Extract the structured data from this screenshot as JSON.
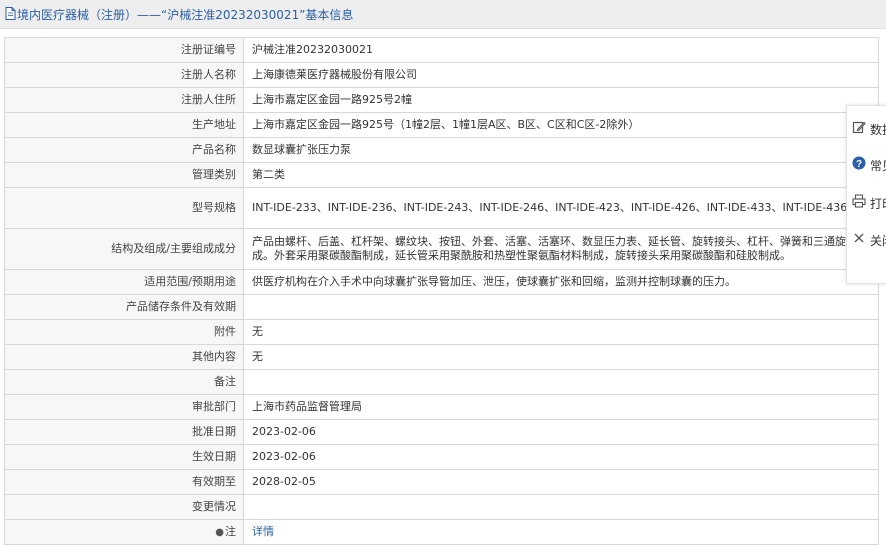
{
  "page": {
    "title": "境内医疗器械（注册）——“沪械注准20232030021”基本信息"
  },
  "rows": [
    {
      "label": "注册证编号",
      "value": "沪械注准20232030021"
    },
    {
      "label": "注册人名称",
      "value": "上海康德莱医疗器械股份有限公司"
    },
    {
      "label": "注册人住所",
      "value": "上海市嘉定区金园一路925号2幢"
    },
    {
      "label": "生产地址",
      "value": "上海市嘉定区金园一路925号（1幢2层、1幢1层A区、B区、C区和C区-2除外）"
    },
    {
      "label": "产品名称",
      "value": "数显球囊扩张压力泵"
    },
    {
      "label": "管理类别",
      "value": "第二类"
    },
    {
      "label": "型号规格",
      "value": "INT-IDE-233、INT-IDE-236、INT-IDE-243、INT-IDE-246、INT-IDE-423、INT-IDE-426、INT-IDE-433、INT-IDE-436"
    },
    {
      "label": "结构及组成/主要组成成分",
      "value": "产品由螺杆、后盖、杠杆架、螺纹块、按钮、外套、活塞、活塞环、数显压力表、延长管、旋转接头、杠杆、弹簧和三通旋塞组成。外套采用聚碳酸酯制成，延长管采用聚酰胺和热塑性聚氨酯材料制成，旋转接头采用聚碳酸酯和硅胶制成。"
    },
    {
      "label": "适用范围/预期用途",
      "value": "供医疗机构在介入手术中向球囊扩张导管加压、泄压，使球囊扩张和回缩，监测并控制球囊的压力。"
    },
    {
      "label": "产品储存条件及有效期",
      "value": ""
    },
    {
      "label": "附件",
      "value": "无"
    },
    {
      "label": "其他内容",
      "value": "无"
    },
    {
      "label": "备注",
      "value": ""
    },
    {
      "label": "审批部门",
      "value": "上海市药品监督管理局"
    },
    {
      "label": "批准日期",
      "value": "2023-02-06"
    },
    {
      "label": "生效日期",
      "value": "2023-02-06"
    },
    {
      "label": "有效期至",
      "value": "2028-02-05"
    },
    {
      "label": "变更情况",
      "value": ""
    }
  ],
  "note": {
    "label": "注",
    "link_text": "详情"
  },
  "float_panel": {
    "items": [
      {
        "label": "数据",
        "icon": "edit-icon"
      },
      {
        "label": "常见",
        "icon": "help-icon"
      },
      {
        "label": "打印",
        "icon": "print-icon"
      },
      {
        "label": "关闭",
        "icon": "close-icon"
      }
    ]
  },
  "colors": {
    "title_text": "#2b5fa6",
    "link": "#2b5fa6",
    "label_bg": "#f7f7f7",
    "border": "#d8d8d8"
  }
}
